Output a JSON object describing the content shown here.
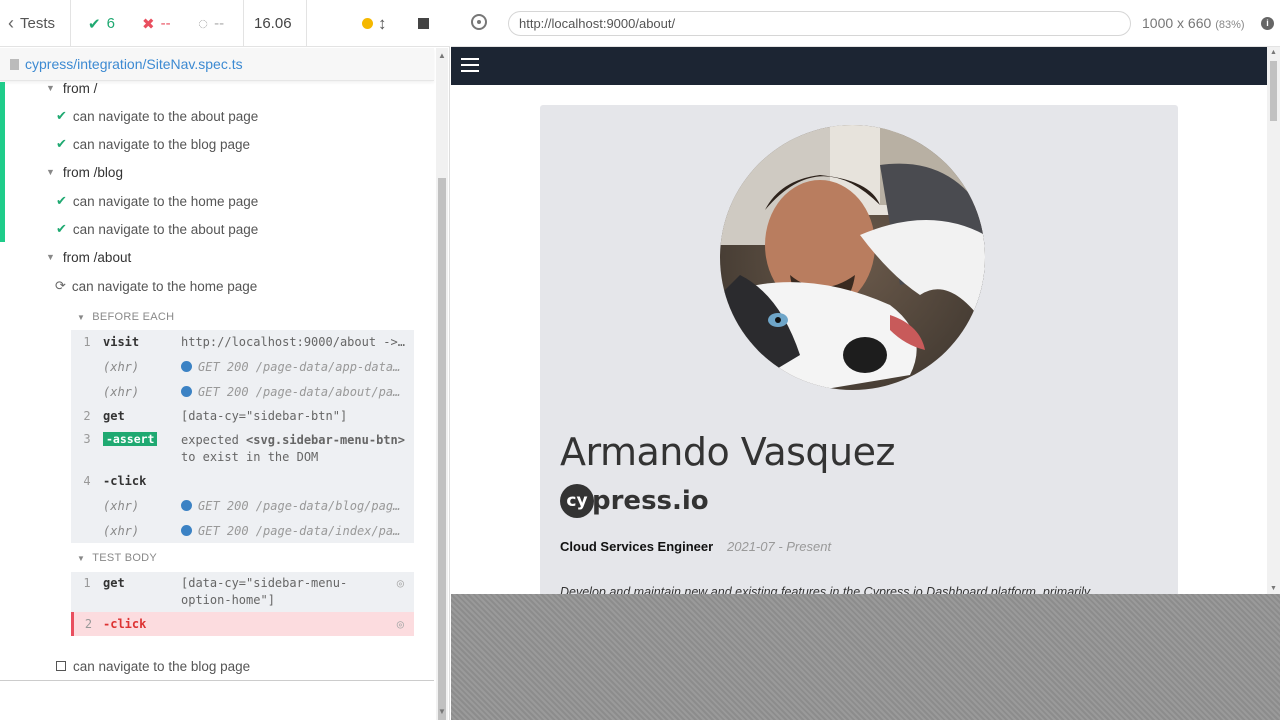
{
  "header": {
    "tests_label": "Tests",
    "passed_count": "6",
    "failed_count": "--",
    "pending_count": "--",
    "duration": "16.06"
  },
  "spec": {
    "path": "cypress/integration/SiteNav.spec.ts"
  },
  "suites": [
    {
      "title": "from /",
      "tests": [
        "can navigate to the about page",
        "can navigate to the blog page"
      ]
    },
    {
      "title": "from /blog",
      "tests": [
        "can navigate to the home page",
        "can navigate to the about page"
      ]
    },
    {
      "title": "from /about",
      "running_test": "can navigate to the home page",
      "pending_test": "can navigate to the blog page"
    }
  ],
  "hooks": {
    "before_each_label": "BEFORE EACH",
    "test_body_label": "TEST BODY"
  },
  "before_each_commands": [
    {
      "num": "1",
      "name": "visit",
      "msg": "http://localhost:9000/about ->..."
    },
    {
      "num": "",
      "name": "(xhr)",
      "msg": "GET 200 /page-data/app-data..."
    },
    {
      "num": "",
      "name": "(xhr)",
      "msg": "GET 200 /page-data/about/pa..."
    },
    {
      "num": "2",
      "name": "get",
      "msg": "[data-cy=\"sidebar-btn\"]"
    },
    {
      "num": "3",
      "name": "-assert",
      "msg_a": "expected",
      "msg_b": "<svg.sidebar-menu-btn>",
      "msg_c": "to exist in the DOM"
    },
    {
      "num": "4",
      "name": "-click",
      "msg": ""
    },
    {
      "num": "",
      "name": "(xhr)",
      "msg": "GET 200 /page-data/blog/pag..."
    },
    {
      "num": "",
      "name": "(xhr)",
      "msg": "GET 200 /page-data/index/pa..."
    }
  ],
  "test_body_commands": [
    {
      "num": "1",
      "name": "get",
      "msg": "[data-cy=\"sidebar-menu-option-home\"]"
    },
    {
      "num": "2",
      "name": "-click",
      "msg": ""
    }
  ],
  "preview": {
    "url": "http://localhost:9000/about/",
    "viewport": "1000 x 660",
    "scale": "(83%)"
  },
  "profile": {
    "name": "Armando Vasquez",
    "company_logo_cy": "cy",
    "company_logo_rest": "press.io",
    "job_title": "Cloud Services Engineer",
    "job_dates": "2021-07 - Present",
    "job_description": "Develop and maintain new and existing features in the Cypress.io Dashboard platform, primarily"
  },
  "colors": {
    "pass": "#1fa971",
    "fail": "#e94f5f",
    "nav_bg": "#1c2533",
    "card_bg": "#e5e6ea"
  }
}
